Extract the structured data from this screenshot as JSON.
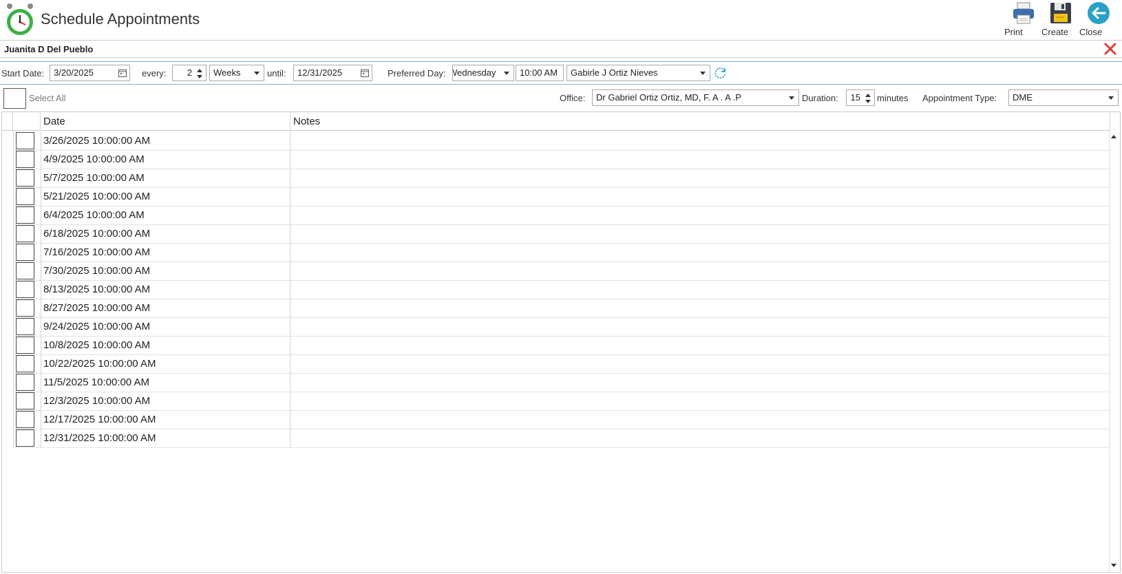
{
  "window": {
    "title": "Schedule Appointments"
  },
  "toolbar": {
    "print_label": "Print",
    "create_label": "Create",
    "close_label": "Close"
  },
  "patient": {
    "name": "Juanita D Del Pueblo"
  },
  "recurrence": {
    "start_label": "Start Date:",
    "start_value": "3/20/2025",
    "every_label": "every:",
    "every_value": "2",
    "unit_value": "Weeks",
    "until_label": "until:",
    "until_value": "12/31/2025",
    "preferred_label": "Preferred Day:",
    "preferred_day": "Wednesday",
    "time_value": "10:00 AM",
    "provider_value": "Gabirle J Ortiz Nieves"
  },
  "options": {
    "select_all_label": "Select All",
    "office_label": "Office:",
    "office_value": "Dr Gabriel Ortiz Ortiz, MD, F. A . A .P",
    "duration_label": "Duration:",
    "duration_value": "15",
    "minutes_label": "minutes",
    "appt_type_label": "Appointment Type:",
    "appt_type_value": "DME"
  },
  "grid": {
    "columns": [
      "Date",
      "Notes"
    ],
    "rows": [
      {
        "date": "3/26/2025 10:00:00 AM",
        "notes": ""
      },
      {
        "date": "4/9/2025 10:00:00 AM",
        "notes": ""
      },
      {
        "date": "5/7/2025 10:00:00 AM",
        "notes": ""
      },
      {
        "date": "5/21/2025 10:00:00 AM",
        "notes": ""
      },
      {
        "date": "6/4/2025 10:00:00 AM",
        "notes": ""
      },
      {
        "date": "6/18/2025 10:00:00 AM",
        "notes": ""
      },
      {
        "date": "7/16/2025 10:00:00 AM",
        "notes": ""
      },
      {
        "date": "7/30/2025 10:00:00 AM",
        "notes": ""
      },
      {
        "date": "8/13/2025 10:00:00 AM",
        "notes": ""
      },
      {
        "date": "8/27/2025 10:00:00 AM",
        "notes": ""
      },
      {
        "date": "9/24/2025 10:00:00 AM",
        "notes": ""
      },
      {
        "date": "10/8/2025 10:00:00 AM",
        "notes": ""
      },
      {
        "date": "10/22/2025 10:00:00 AM",
        "notes": ""
      },
      {
        "date": "11/5/2025 10:00:00 AM",
        "notes": ""
      },
      {
        "date": "12/3/2025 10:00:00 AM",
        "notes": ""
      },
      {
        "date": "12/17/2025 10:00:00 AM",
        "notes": ""
      },
      {
        "date": "12/31/2025 10:00:00 AM",
        "notes": ""
      }
    ]
  },
  "icons": {
    "app": "alarm-clock-icon",
    "print": "printer-icon",
    "create": "floppy-disk-icon",
    "close": "back-arrow-icon",
    "clear": "close-x-icon",
    "refresh": "refresh-icon",
    "calendar": "calendar-icon"
  },
  "colors": {
    "accent": "#2aa0c8",
    "clear_red": "#e03a3a",
    "clock_green": "#3cb043",
    "separator_blue": "#7fb3d3"
  }
}
